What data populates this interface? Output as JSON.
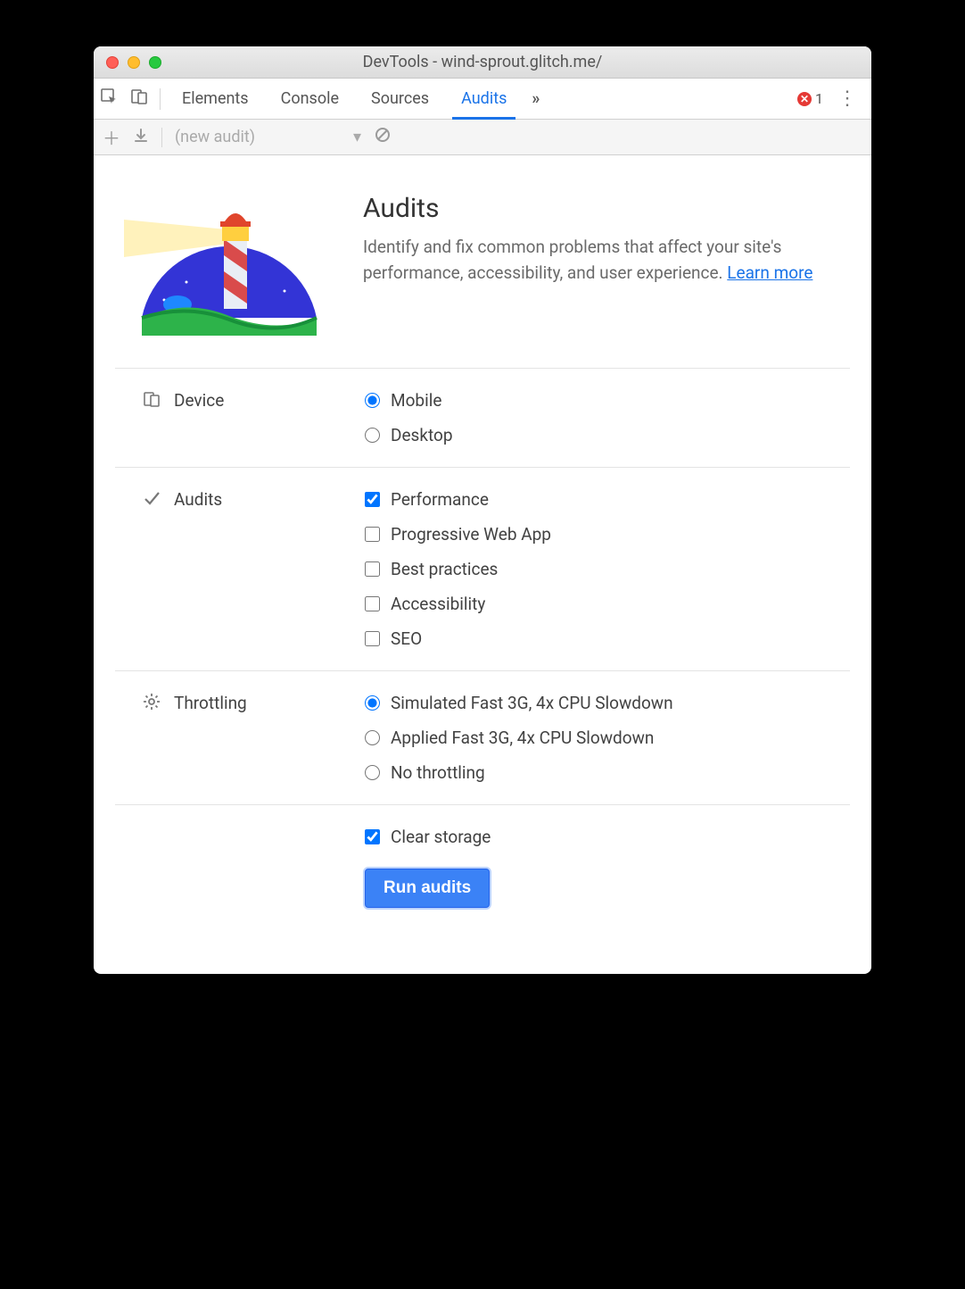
{
  "window": {
    "title": "DevTools - wind-sprout.glitch.me/"
  },
  "tabs": {
    "items": [
      "Elements",
      "Console",
      "Sources",
      "Audits"
    ],
    "active": 3,
    "error_count": "1"
  },
  "subbar": {
    "dropdown": "(new audit)"
  },
  "hero": {
    "title": "Audits",
    "body": "Identify and fix common problems that affect your site's performance, accessibility, and user experience. ",
    "learn_more": "Learn more"
  },
  "sections": {
    "device": {
      "label": "Device",
      "options": [
        {
          "label": "Mobile",
          "checked": true
        },
        {
          "label": "Desktop",
          "checked": false
        }
      ]
    },
    "audits": {
      "label": "Audits",
      "options": [
        {
          "label": "Performance",
          "checked": true
        },
        {
          "label": "Progressive Web App",
          "checked": false
        },
        {
          "label": "Best practices",
          "checked": false
        },
        {
          "label": "Accessibility",
          "checked": false
        },
        {
          "label": "SEO",
          "checked": false
        }
      ]
    },
    "throttling": {
      "label": "Throttling",
      "options": [
        {
          "label": "Simulated Fast 3G, 4x CPU Slowdown",
          "checked": true
        },
        {
          "label": "Applied Fast 3G, 4x CPU Slowdown",
          "checked": false
        },
        {
          "label": "No throttling",
          "checked": false
        }
      ]
    },
    "storage": {
      "label": "Clear storage",
      "checked": true
    }
  },
  "run_button": "Run audits"
}
